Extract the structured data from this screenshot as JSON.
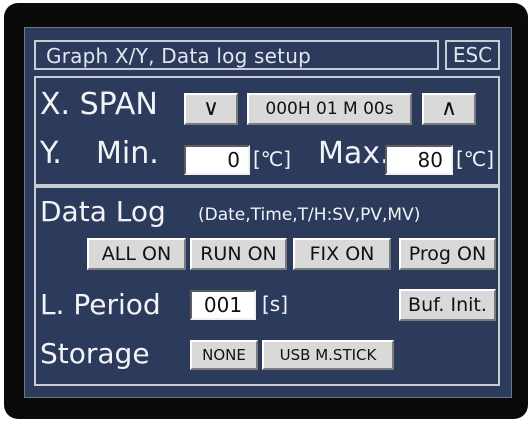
{
  "title": "Graph X/Y, Data log setup",
  "esc_label": "ESC",
  "xspan": {
    "label": "X. SPAN",
    "down_symbol": "∨",
    "up_symbol": "∧",
    "value": "000H 01 M 00s"
  },
  "y_axis": {
    "label": "Y.",
    "min_label": "Min.",
    "min_value": "0",
    "min_unit": "[℃]",
    "max_label": "Max.",
    "max_value": "80",
    "max_unit": "[℃]"
  },
  "data_log": {
    "label": "Data Log",
    "hint": "(Date,Time,T/H:SV,PV,MV)",
    "buttons": [
      "ALL ON",
      "RUN ON",
      "FIX ON",
      "Prog ON"
    ]
  },
  "log_period": {
    "label": "L. Period",
    "value": "001",
    "unit": "[s]",
    "buf_init_label": "Buf. Init."
  },
  "storage": {
    "label": "Storage",
    "options": [
      "NONE",
      "USB M.STICK"
    ]
  }
}
